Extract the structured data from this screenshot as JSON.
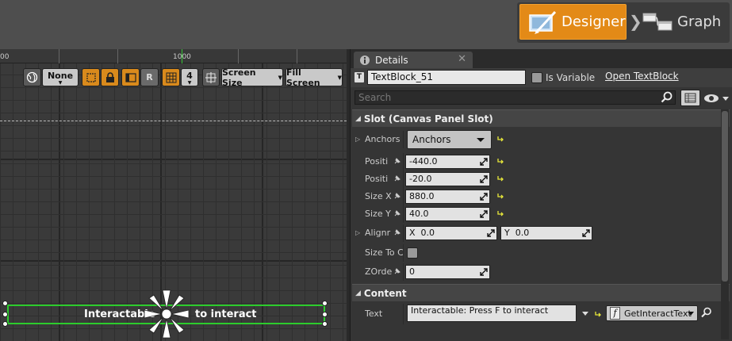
{
  "modes": {
    "designer_label": "Designer",
    "graph_label": "Graph",
    "separator": "❯"
  },
  "canvas": {
    "ruler": {
      "left_label": "00",
      "mid_label": "1000"
    },
    "toolbar": {
      "none_label": "None",
      "r_label": "R",
      "grid_value": "4",
      "screen_size_label": "Screen Size",
      "fill_screen_label": "Fill Screen"
    },
    "widget": {
      "text_left": "Interactable",
      "text_right": "to interact"
    }
  },
  "details": {
    "tab_label": "Details",
    "tab_close": "✕",
    "widget_name": "TextBlock_51",
    "is_variable_label": "Is Variable",
    "open_link": "Open TextBlock",
    "search_placeholder": "Search",
    "slot_section": {
      "title": "Slot (Canvas Panel Slot)",
      "rows": {
        "anchors": {
          "label": "Anchors",
          "value": "Anchors"
        },
        "pos_x": {
          "label": "Positi",
          "value": "-440.0"
        },
        "pos_y": {
          "label": "Positi",
          "value": "-20.0"
        },
        "size_x": {
          "label": "Size X",
          "value": "880.0"
        },
        "size_y": {
          "label": "Size Y",
          "value": "40.0"
        },
        "alignment": {
          "label": "Alignr",
          "x_label": "X",
          "x_value": "0.0",
          "y_label": "Y",
          "y_value": "0.0"
        },
        "size_to_content": {
          "label": "Size To C"
        },
        "zorder": {
          "label": "ZOrder",
          "value": "0"
        }
      }
    },
    "content_section": {
      "title": "Content",
      "text_label": "Text",
      "text_value": "Interactable: Press F to interact",
      "binding_label": "GetInteractText"
    }
  },
  "colors": {
    "accent_orange": "#e38a17",
    "selection_green": "#2ccc2c",
    "panel_bg": "#353535"
  }
}
